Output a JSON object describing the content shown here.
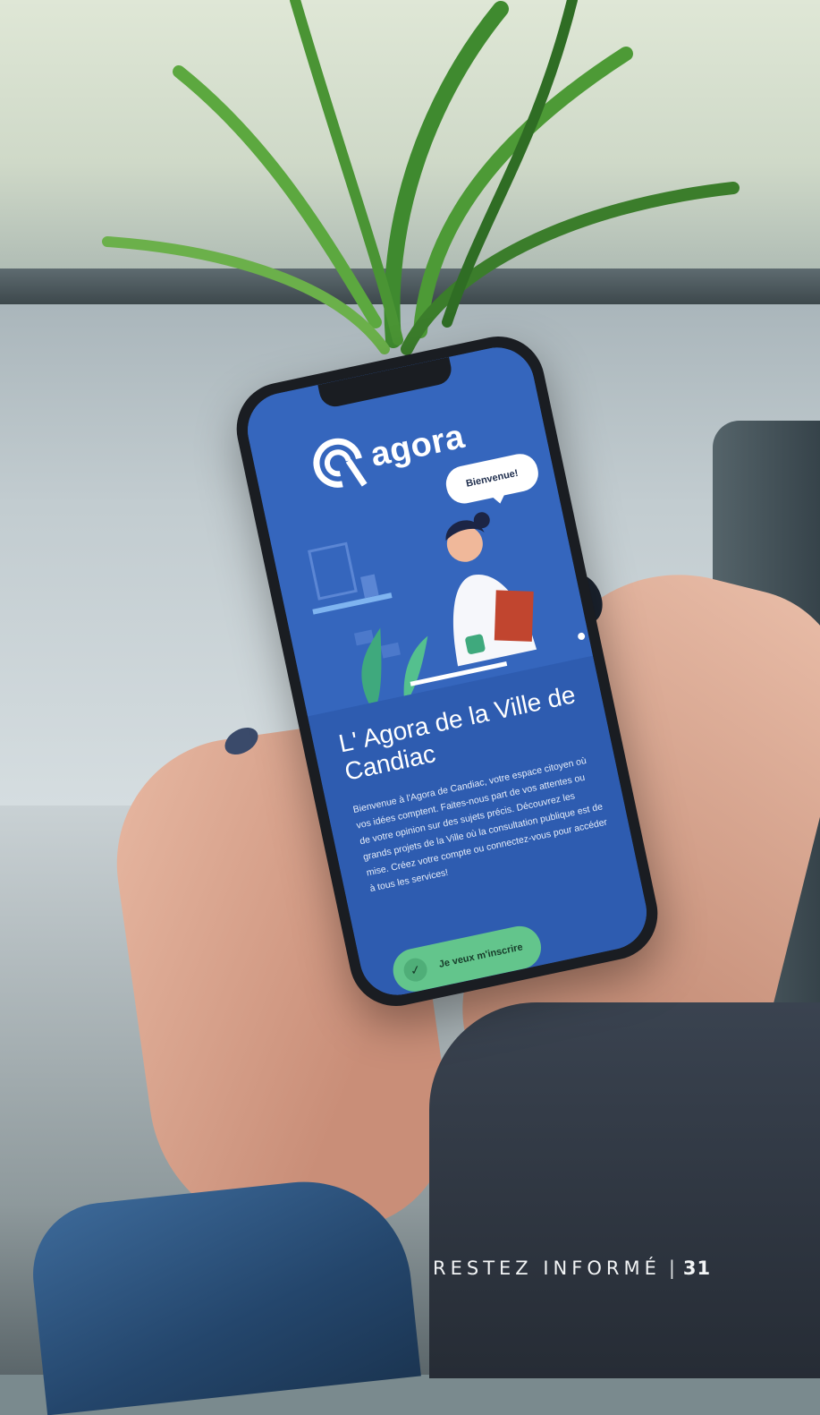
{
  "app": {
    "brand_name": "agora",
    "speech_bubble": "Bienvenue!",
    "headline": "L' Agora de la Ville de Candiac",
    "description": "Bienvenue à l'Agora de Candiac, votre espace citoyen où vos idées comptent. Faites-nous part de vos attentes ou de votre opinion sur des sujets précis. Découvrez les grands projets de la Ville où la consultation publique est de mise. Créez votre compte ou connectez-vous pour accéder à tous les services!",
    "cta_label": "Je veux m'inscrire",
    "cta_icon": "check-icon"
  },
  "colors": {
    "brand_blue": "#2e5cb0",
    "cta_green": "#63c58c"
  },
  "footer": {
    "section_label": "RESTEZ INFORMÉ",
    "separator": "|",
    "page_number": "31"
  }
}
